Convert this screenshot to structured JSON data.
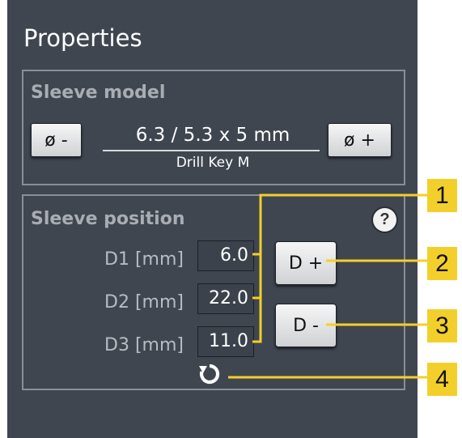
{
  "panel": {
    "title": "Properties"
  },
  "sleeve_model": {
    "title": "Sleeve model",
    "decrease_diameter_label": "ø -",
    "increase_diameter_label": "ø +",
    "size": "6.3 / 5.3 x 5 mm",
    "drill_key": "Drill Key M"
  },
  "sleeve_position": {
    "title": "Sleeve position",
    "help_label": "?",
    "rows": [
      {
        "label": "D1 [mm]",
        "value": "6.0"
      },
      {
        "label": "D2 [mm]",
        "value": "22.0"
      },
      {
        "label": "D3 [mm]",
        "value": "11.0"
      }
    ],
    "d_plus_label": "D +",
    "d_minus_label": "D -",
    "reset_icon": "rotate-reset-icon"
  },
  "callouts": [
    "1",
    "2",
    "3",
    "4"
  ],
  "colors": {
    "panel_bg": "#3f4650",
    "callout_bg": "#f3cf2b",
    "leader_line": "#f3cf2b",
    "group_border": "#8a8f97"
  }
}
